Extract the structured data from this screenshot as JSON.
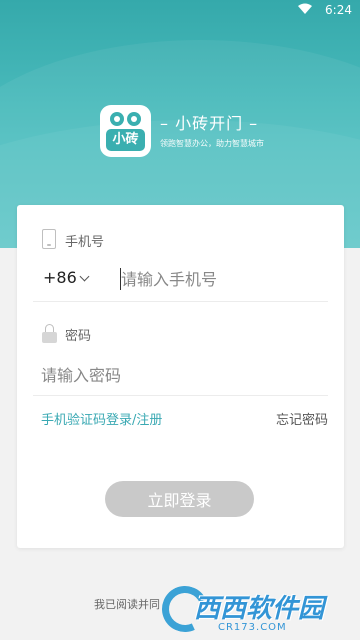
{
  "status_bar": {
    "time": "6:24",
    "wifi_icon": "wifi-icon"
  },
  "brand": {
    "logo_text": "小砖",
    "name": "– 小砖开门 –",
    "slogan": "领跑智慧办公，助力智慧城市"
  },
  "login_form": {
    "phone_label": "手机号",
    "country_code": "+86",
    "phone_placeholder": "请输入手机号",
    "password_label": "密码",
    "password_placeholder": "请输入密码",
    "sms_login_link": "手机验证码登录/注册",
    "forgot_password_link": "忘记密码",
    "login_button": "立即登录"
  },
  "agreement_text": "我已阅读并同",
  "watermark": {
    "text": "西西软件园",
    "url": "CR173.COM"
  },
  "colors": {
    "accent": "#3aa9b3",
    "hero_top": "#35a9ab",
    "button_disabled": "#c9c9c9"
  }
}
